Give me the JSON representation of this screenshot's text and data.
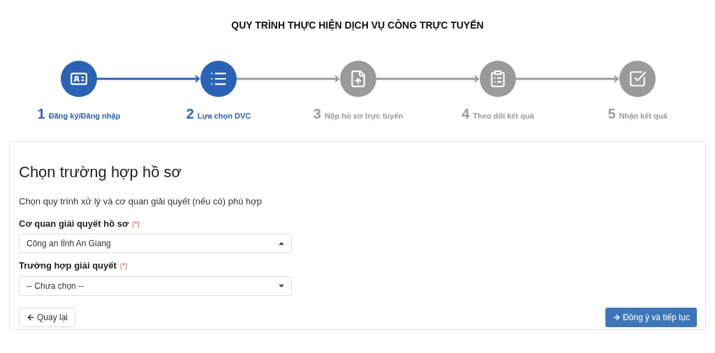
{
  "title": "QUY TRÌNH THỰC HIỆN DỊCH VỤ CÔNG TRỰC TUYẾN",
  "steps": [
    {
      "number": "1",
      "label": "Đăng ký/Đăng nhập",
      "active": true
    },
    {
      "number": "2",
      "label": "Lựa chọn DVC",
      "active": true
    },
    {
      "number": "3",
      "label": "Nộp hồ sơ trực tuyến",
      "active": false
    },
    {
      "number": "4",
      "label": "Theo dõi kết quả",
      "active": false
    },
    {
      "number": "5",
      "label": "Nhận kết quả",
      "active": false
    }
  ],
  "form": {
    "heading": "Chọn trường hợp hồ sơ",
    "description": "Chọn quy trình xử lý và cơ quan giải quyết (nếu có) phù hợp",
    "fields": [
      {
        "label": "Cơ quan giải quyết hồ sơ",
        "required_mark": "(*)",
        "value": "Công an tỉnh An Giang",
        "expanded": true
      },
      {
        "label": "Trường hợp giải quyết",
        "required_mark": "(*)",
        "value": "-- Chưa chọn --",
        "expanded": false
      }
    ],
    "back_button": "Quay lại",
    "next_button": "Đồng ý và tiếp tục"
  }
}
